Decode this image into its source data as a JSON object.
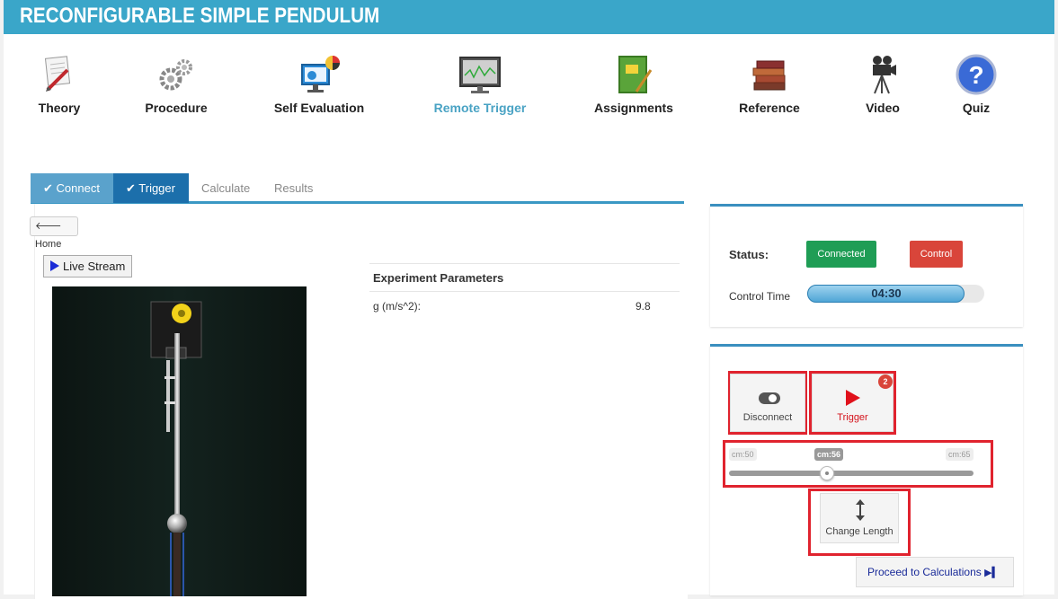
{
  "header": {
    "title": "RECONFIGURABLE SIMPLE PENDULUM"
  },
  "nav": {
    "items": [
      {
        "label": "Theory",
        "icon": "theory-icon"
      },
      {
        "label": "Procedure",
        "icon": "gears-icon"
      },
      {
        "label": "Self Evaluation",
        "icon": "evaluation-icon"
      },
      {
        "label": "Remote Trigger",
        "icon": "monitor-icon",
        "active": true
      },
      {
        "label": "Assignments",
        "icon": "notebook-icon"
      },
      {
        "label": "Reference",
        "icon": "books-icon"
      },
      {
        "label": "Video",
        "icon": "camera-icon"
      },
      {
        "label": "Quiz",
        "icon": "question-icon"
      }
    ]
  },
  "tabs": [
    {
      "label": "Connect",
      "checked": true
    },
    {
      "label": "Trigger",
      "checked": true
    },
    {
      "label": "Calculate"
    },
    {
      "label": "Results"
    }
  ],
  "left": {
    "home_label": "Home",
    "live_stream_label": "Live Stream"
  },
  "params": {
    "header": "Experiment Parameters",
    "rows": [
      {
        "label": "g (m/s^2):",
        "value": "9.8"
      }
    ]
  },
  "status": {
    "label": "Status:",
    "connected_label": "Connected",
    "control_label": "Control",
    "control_time_label": "Control Time",
    "control_time_value": "04:30",
    "control_time_fraction": 0.89
  },
  "controls": {
    "disconnect_label": "Disconnect",
    "trigger_label": "Trigger",
    "trigger_badge": "2",
    "slider": {
      "min_label": "cm:50",
      "current_label": "cm:56",
      "max_label": "cm:65",
      "min": 50,
      "max": 65,
      "value": 56
    },
    "change_length_label": "Change Length",
    "proceed_label": "Proceed to Calculations"
  },
  "colors": {
    "header": "#3aa6c9",
    "accent_active": "#4aa3c4",
    "connected": "#1f9d55",
    "control": "#d9453a",
    "highlight_box": "#e0232e"
  }
}
